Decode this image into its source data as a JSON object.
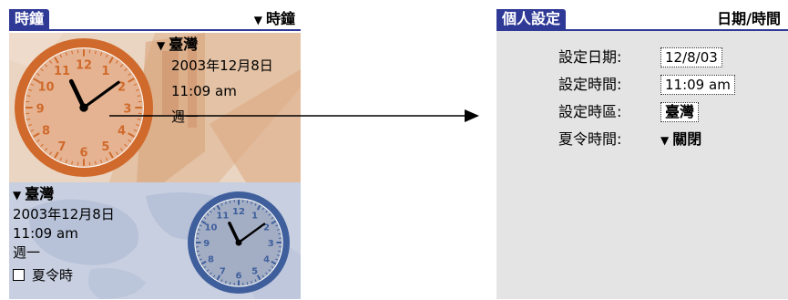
{
  "left": {
    "title_tab": "時鐘",
    "title_right": "時鐘",
    "top_clock": {
      "location": "臺灣",
      "date": "2003年12月8日",
      "time": "11:09 am",
      "weekday": "週一",
      "numerals": [
        "12",
        "1",
        "2",
        "3",
        "4",
        "5",
        "6",
        "7",
        "8",
        "9",
        "10",
        "11"
      ]
    },
    "bottom_clock": {
      "location": "臺灣",
      "date": "2003年12月8日",
      "time": "11:09 am",
      "weekday": "週一",
      "dst_label": "夏令時",
      "dst_checked": false,
      "numerals": [
        "12",
        "1",
        "2",
        "3",
        "4",
        "5",
        "6",
        "7",
        "8",
        "9",
        "10",
        "11"
      ]
    }
  },
  "right": {
    "title_tab": "個人設定",
    "title_right": "日期/時間",
    "fields": {
      "set_date_label": "設定日期:",
      "set_date_value": "12/8/03",
      "set_time_label": "設定時間:",
      "set_time_value": "11:09 am",
      "set_zone_label": "設定時區:",
      "set_zone_value": "臺灣",
      "dst_label": "夏令時間:",
      "dst_value": "關閉"
    }
  },
  "colors": {
    "title_bar": "#2f3a96",
    "top_panel": "#ead5c3",
    "bottom_panel": "#c8cfe0",
    "clock_orange": "#d06a2c",
    "clock_blue": "#3f5f9c",
    "right_bg": "#e4e4e4"
  }
}
